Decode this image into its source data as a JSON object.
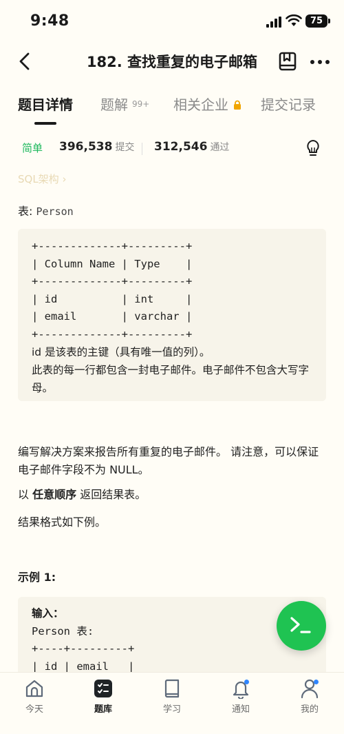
{
  "status": {
    "time": "9:48",
    "battery": "75"
  },
  "nav": {
    "title": "182. 查找重复的电子邮箱"
  },
  "tabs": [
    {
      "label": "题目详情",
      "active": true
    },
    {
      "label": "题解",
      "badge": "99+"
    },
    {
      "label": "相关企业",
      "locked": true
    },
    {
      "label": "提交记录"
    }
  ],
  "stats": {
    "difficulty": "简单",
    "submissions": "396,538",
    "submissions_label": "提交",
    "accepted": "312,546",
    "accepted_label": "通过"
  },
  "category_link": "SQL架构 ›",
  "table_label": {
    "prefix": "表: ",
    "name": "Person"
  },
  "schema": {
    "code": "+-------------+---------+\n| Column Name | Type    |\n+-------------+---------+\n| id          | int     |\n| email       | varchar |\n+-------------+---------+",
    "note1": "id 是该表的主键（具有唯一值的列）。",
    "note2": "此表的每一行都包含一封电子邮件。电子邮件不包含大写字母。"
  },
  "description": {
    "p1": "编写解决方案来报告所有重复的电子邮件。 请注意，可以保证电子邮件字段不为 NULL。",
    "p2_pre": "以 ",
    "p2_bold": "任意顺序",
    "p2_post": " 返回结果表。",
    "p3": "结果格式如下例。"
  },
  "example": {
    "title": "示例 1:",
    "input_label": "输入：",
    "code": "Person 表:\n+----+---------+\n| id | email   |"
  },
  "bottom_nav": [
    {
      "label": "今天",
      "icon": "home-icon"
    },
    {
      "label": "题库",
      "icon": "problem-list-icon",
      "active": true
    },
    {
      "label": "学习",
      "icon": "book-icon"
    },
    {
      "label": "通知",
      "icon": "bell-icon",
      "dot": true
    },
    {
      "label": "我的",
      "icon": "profile-icon",
      "dot": true
    }
  ],
  "colors": {
    "accent_green": "#1fc352",
    "difficulty_green": "#1cb85c",
    "notify_blue": "#2f86ff",
    "background": "#fffdf6"
  }
}
